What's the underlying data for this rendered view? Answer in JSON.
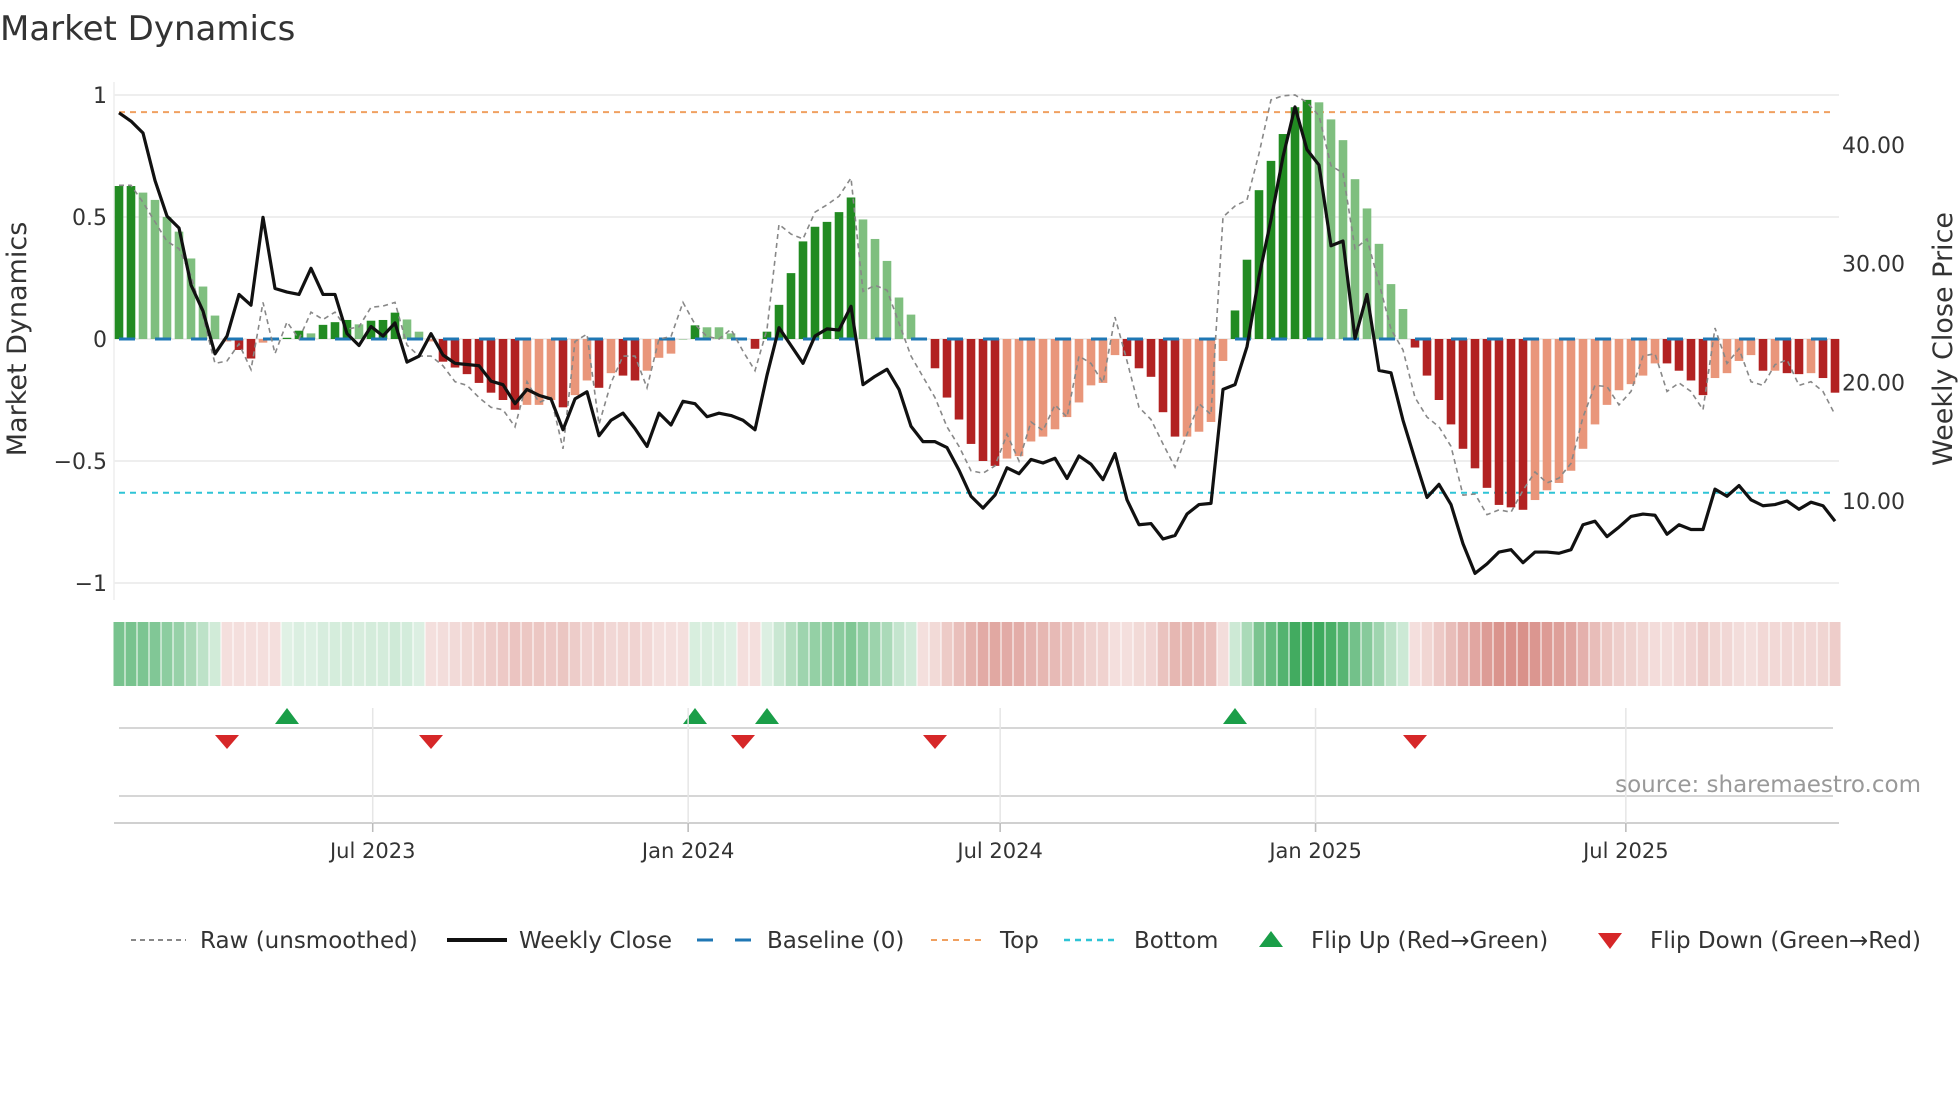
{
  "chart_data": {
    "type": "bar",
    "title": "Market Dynamics",
    "ylabel": "Market Dynamics",
    "y2label": "Weekly Close Price",
    "ylim": [
      -1,
      1
    ],
    "y2lim": [
      2,
      46
    ],
    "yticks": [
      "1",
      "0.5",
      "0",
      "−0.5",
      "−1"
    ],
    "ytick_values": [
      1,
      0.5,
      0,
      -0.5,
      -1
    ],
    "y2ticks": [
      "40.00",
      "30.00",
      "20.00",
      "10.00"
    ],
    "y2tick_values": [
      40,
      30,
      20,
      10
    ],
    "grid": true,
    "start_date": "2023-02-03",
    "frequency": "weekly",
    "xticks": [
      {
        "label": "Jul 2023",
        "date": "2023-07-01"
      },
      {
        "label": "Jan 2024",
        "date": "2024-01-01"
      },
      {
        "label": "Jul 2024",
        "date": "2024-07-01"
      },
      {
        "label": "Jan 2025",
        "date": "2025-01-01"
      },
      {
        "label": "Jul 2025",
        "date": "2025-07-01"
      }
    ],
    "top_level": 0.93,
    "bottom_level": -0.63,
    "baseline": 0,
    "smoothed": [
      0.627,
      0.627,
      0.6,
      0.57,
      0.5,
      0.44,
      0.33,
      0.215,
      0.096,
      -0.01,
      -0.045,
      -0.08,
      -0.015,
      0.0,
      0.005,
      0.034,
      0.023,
      0.058,
      0.069,
      0.078,
      0.06,
      0.075,
      0.078,
      0.108,
      0.08,
      0.03,
      -0.01,
      -0.093,
      -0.117,
      -0.144,
      -0.18,
      -0.22,
      -0.25,
      -0.29,
      -0.27,
      -0.27,
      -0.25,
      -0.28,
      -0.23,
      -0.17,
      -0.2,
      -0.14,
      -0.15,
      -0.17,
      -0.13,
      -0.077,
      -0.06,
      0.0,
      0.056,
      0.048,
      0.048,
      0.023,
      0.0,
      -0.04,
      0.03,
      0.14,
      0.27,
      0.4,
      0.46,
      0.48,
      0.52,
      0.58,
      0.49,
      0.41,
      0.32,
      0.17,
      0.1,
      0.0,
      -0.12,
      -0.24,
      -0.33,
      -0.43,
      -0.5,
      -0.52,
      -0.49,
      -0.48,
      -0.42,
      -0.4,
      -0.37,
      -0.32,
      -0.26,
      -0.19,
      -0.18,
      -0.066,
      -0.07,
      -0.12,
      -0.155,
      -0.3,
      -0.4,
      -0.4,
      -0.38,
      -0.34,
      -0.09,
      0.117,
      0.325,
      0.61,
      0.73,
      0.84,
      0.95,
      0.98,
      0.97,
      0.9,
      0.815,
      0.655,
      0.535,
      0.39,
      0.225,
      0.123,
      -0.035,
      -0.15,
      -0.25,
      -0.35,
      -0.45,
      -0.53,
      -0.61,
      -0.68,
      -0.69,
      -0.7,
      -0.66,
      -0.62,
      -0.59,
      -0.54,
      -0.45,
      -0.35,
      -0.27,
      -0.21,
      -0.185,
      -0.15,
      -0.1,
      -0.1,
      -0.13,
      -0.17,
      -0.23,
      -0.16,
      -0.14,
      -0.09,
      -0.066,
      -0.13,
      -0.13,
      -0.14,
      -0.144,
      -0.14,
      -0.16,
      -0.22
    ],
    "shade": "DDLLLLLLLLDDLLDDLDDDLDDDLLLDDDDDDDLLLDLLDLDDLLLLDLLLLDDDDDDDDDLLLLLLDDDDDDLLLLLLLLLLDDDDDLLLLDDDDDDDLLLLLLLLDDDDDDDDDDLLLLLLLLLLLDDDDLLLLDLDDLDD",
    "raw": [
      0.63,
      0.63,
      0.56,
      0.48,
      0.4,
      0.37,
      0.26,
      0.09,
      -0.1,
      -0.09,
      -0.02,
      -0.125,
      0.15,
      -0.06,
      0.07,
      0.0,
      0.11,
      0.08,
      0.11,
      0.04,
      0.05,
      0.13,
      0.135,
      0.15,
      -0.025,
      -0.07,
      -0.07,
      -0.11,
      -0.175,
      -0.19,
      -0.24,
      -0.28,
      -0.29,
      -0.36,
      -0.175,
      -0.26,
      -0.24,
      -0.45,
      -0.01,
      0.02,
      -0.35,
      -0.18,
      -0.07,
      -0.07,
      -0.2,
      0.0,
      0.01,
      0.15,
      0.06,
      0.01,
      0.0,
      0.04,
      -0.05,
      -0.13,
      0.04,
      0.47,
      0.43,
      0.41,
      0.52,
      0.55,
      0.585,
      0.66,
      0.195,
      0.22,
      0.2,
      0.065,
      -0.07,
      -0.155,
      -0.24,
      -0.36,
      -0.44,
      -0.54,
      -0.55,
      -0.52,
      -0.39,
      -0.5,
      -0.34,
      -0.375,
      -0.27,
      -0.32,
      -0.07,
      -0.1,
      -0.18,
      0.09,
      -0.09,
      -0.28,
      -0.33,
      -0.43,
      -0.525,
      -0.39,
      -0.265,
      -0.31,
      0.5,
      0.545,
      0.57,
      0.76,
      0.98,
      0.997,
      1.0,
      0.97,
      0.915,
      0.71,
      0.68,
      0.37,
      0.41,
      0.23,
      0.04,
      -0.045,
      -0.24,
      -0.32,
      -0.36,
      -0.44,
      -0.64,
      -0.635,
      -0.72,
      -0.7,
      -0.71,
      -0.62,
      -0.545,
      -0.59,
      -0.57,
      -0.51,
      -0.32,
      -0.19,
      -0.195,
      -0.27,
      -0.215,
      -0.07,
      -0.06,
      -0.215,
      -0.18,
      -0.215,
      -0.29,
      0.045,
      -0.1,
      -0.04,
      -0.175,
      -0.19,
      -0.105,
      -0.085,
      -0.19,
      -0.175,
      -0.215,
      -0.31
    ],
    "close": [
      42.7,
      42.0,
      41.0,
      37.0,
      34.0,
      33.0,
      28.2,
      26.0,
      22.4,
      23.9,
      27.4,
      26.5,
      33.9,
      27.9,
      27.6,
      27.4,
      29.6,
      27.4,
      27.4,
      24.1,
      23.1,
      24.7,
      23.9,
      25.0,
      21.7,
      22.2,
      24.1,
      22.3,
      21.6,
      21.5,
      21.4,
      20.1,
      19.8,
      18.2,
      19.4,
      18.9,
      18.6,
      16.0,
      18.6,
      19.2,
      15.5,
      16.8,
      17.4,
      16.1,
      14.6,
      17.4,
      16.4,
      18.4,
      18.2,
      17.1,
      17.4,
      17.2,
      16.8,
      16.0,
      20.6,
      24.6,
      23.1,
      21.6,
      23.9,
      24.5,
      24.4,
      26.4,
      19.8,
      20.5,
      21.1,
      19.4,
      16.3,
      15.0,
      15.0,
      14.5,
      12.6,
      10.4,
      9.4,
      10.5,
      12.8,
      12.3,
      13.5,
      13.2,
      13.6,
      11.9,
      13.8,
      13.1,
      11.8,
      14.0,
      10.1,
      8.0,
      8.1,
      6.8,
      7.1,
      8.9,
      9.7,
      9.8,
      19.4,
      19.8,
      23.0,
      28.9,
      33.7,
      39.0,
      43.2,
      39.6,
      38.3,
      31.5,
      31.9,
      23.7,
      27.4,
      21.0,
      20.8,
      16.8,
      13.5,
      10.3,
      11.4,
      9.7,
      6.4,
      3.9,
      4.7,
      5.7,
      5.9,
      4.8,
      5.7,
      5.7,
      5.6,
      5.9,
      8.0,
      8.3,
      7.0,
      7.8,
      8.7,
      8.9,
      8.8,
      7.2,
      8.0,
      7.6,
      7.6,
      11.0,
      10.4,
      11.3,
      10.1,
      9.6,
      9.7,
      10.0,
      9.3,
      9.9,
      9.6,
      8.3
    ],
    "flip_up_weeks": [
      14,
      48,
      54,
      93
    ],
    "flip_down_weeks": [
      9,
      26,
      52,
      68,
      108
    ],
    "legend": [
      {
        "label": "Raw (unsmoothed)",
        "kind": "raw"
      },
      {
        "label": "Weekly Close",
        "kind": "close"
      },
      {
        "label": "Baseline (0)",
        "kind": "baseline"
      },
      {
        "label": "Top",
        "kind": "top"
      },
      {
        "label": "Bottom",
        "kind": "bottom"
      },
      {
        "label": "Flip Up (Red→Green)",
        "kind": "up"
      },
      {
        "label": "Flip Down (Green→Red)",
        "kind": "down"
      }
    ],
    "legend_position": "bottom",
    "source": "source: sharemaestro.com",
    "colors": {
      "bar_up_strong": "#228b22",
      "bar_up_weak": "#7fbf7f",
      "bar_down_strong": "#b22222",
      "bar_down_weak": "#e9967a",
      "close": "#111111",
      "raw": "#888888",
      "baseline": "#1f77b4",
      "top": "#f0a060",
      "bottom": "#2ec4d6",
      "flip_up": "#1a9e48",
      "flip_down": "#d62728"
    }
  }
}
